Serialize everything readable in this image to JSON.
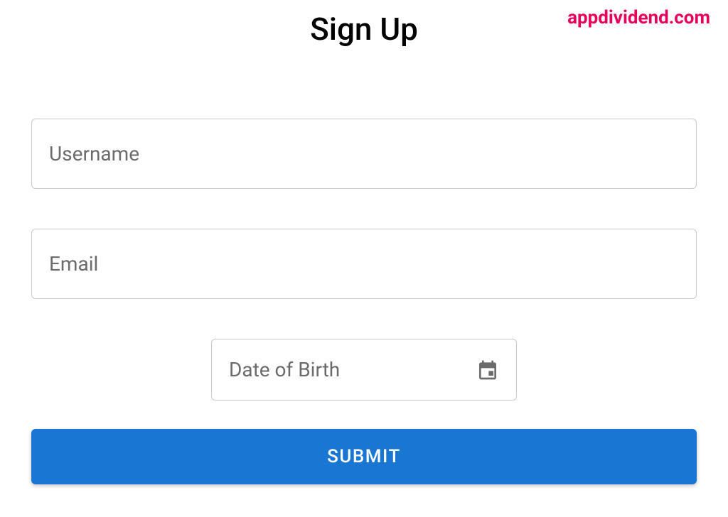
{
  "watermark": "appdividend.com",
  "title": "Sign Up",
  "form": {
    "username": {
      "placeholder": "Username",
      "value": ""
    },
    "email": {
      "placeholder": "Email",
      "value": ""
    },
    "dob": {
      "label": "Date of Birth"
    },
    "submit_label": "SUBMIT"
  },
  "colors": {
    "primary": "#1976d2",
    "watermark": "#e6005c",
    "placeholder": "#6b6b6b",
    "border": "#c9c9c9"
  }
}
